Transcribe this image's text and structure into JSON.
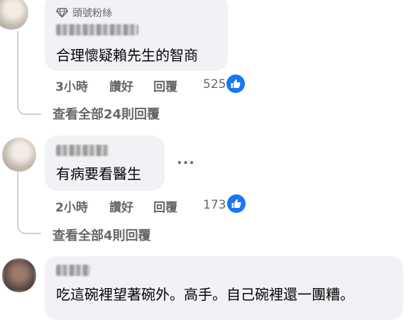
{
  "comments": [
    {
      "badge": "頭號粉絲",
      "text": "合理懷疑賴先生的智商",
      "time": "3小時",
      "like_label": "讚好",
      "reply_label": "回覆",
      "reaction_count": "525",
      "view_replies": "查看全部24則回覆"
    },
    {
      "text": "有病要看醫生",
      "time": "2小時",
      "like_label": "讚好",
      "reply_label": "回覆",
      "reaction_count": "173",
      "view_replies": "查看全部4則回覆",
      "more": "···"
    },
    {
      "text": "吃這碗裡望著碗外。高手。自己碗裡還一團糟。"
    }
  ],
  "colors": {
    "bubble": "#f0f2f5",
    "meta_text": "#65676b",
    "like_blue": "#1877f2",
    "thread_line": "#ccd0d5"
  }
}
